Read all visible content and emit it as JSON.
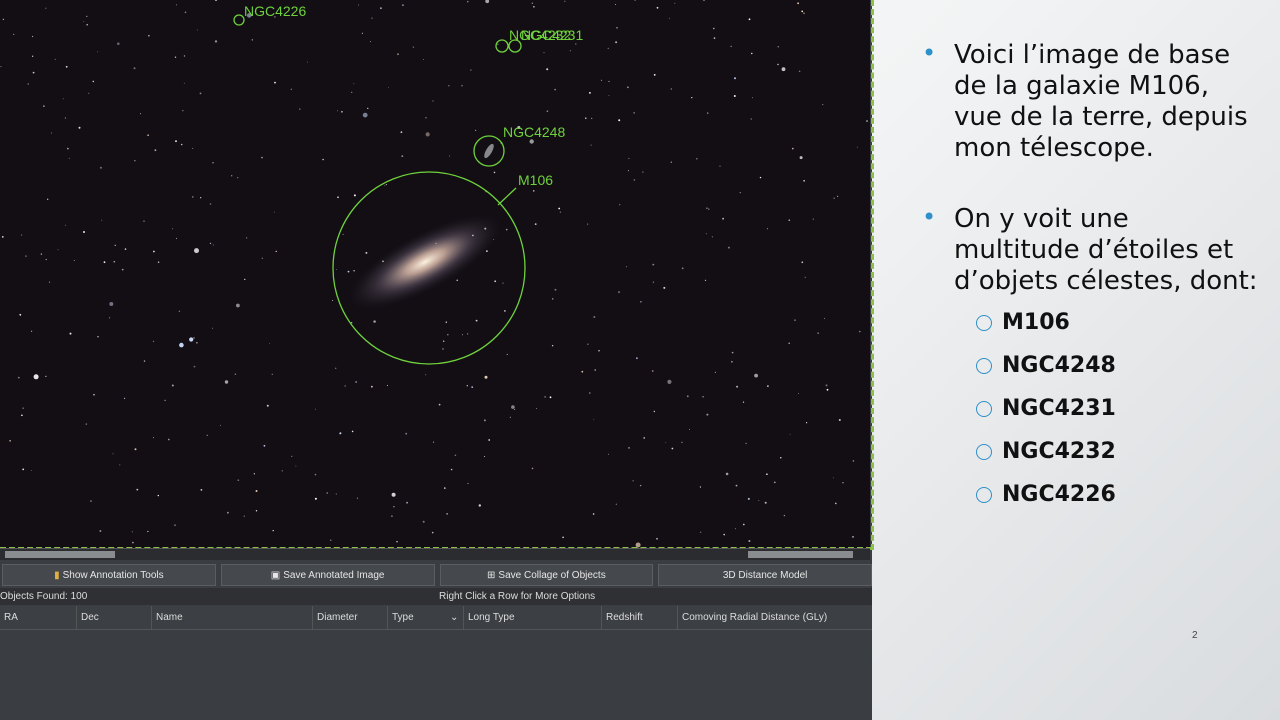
{
  "sky_labels": {
    "ngc4226": "NGC4226",
    "ngc4232": "NGC4232",
    "ngc4231": "NGC4231",
    "ngc4248": "NGC4248",
    "m106": "M106"
  },
  "toolbar": {
    "annotation": "Show Annotation Tools",
    "save_annotated": "Save Annotated Image",
    "save_collage": "Save Collage of Objects",
    "distance_model": "3D Distance Model"
  },
  "status": {
    "found": "Objects Found: 100",
    "hint": "Right Click a Row for More Options"
  },
  "columns": [
    "RA",
    "Dec",
    "Name",
    "Diameter",
    "Type",
    "Long Type",
    "Redshift",
    "Comoving Radial Distance (GLy)"
  ],
  "slide": {
    "bullet1": "Voici l’image de base de la galaxie M106, vue de la terre, depuis mon télescope.",
    "bullet2": "On y voit une multitude d’étoiles et d’objets célestes, dont:",
    "items": [
      "M106",
      "NGC4248",
      "NGC4231",
      "NGC4232",
      "NGC4226"
    ],
    "page_number": "2"
  },
  "colors": {
    "annotation": "#6fd23c",
    "bullet": "#2e90c8"
  }
}
